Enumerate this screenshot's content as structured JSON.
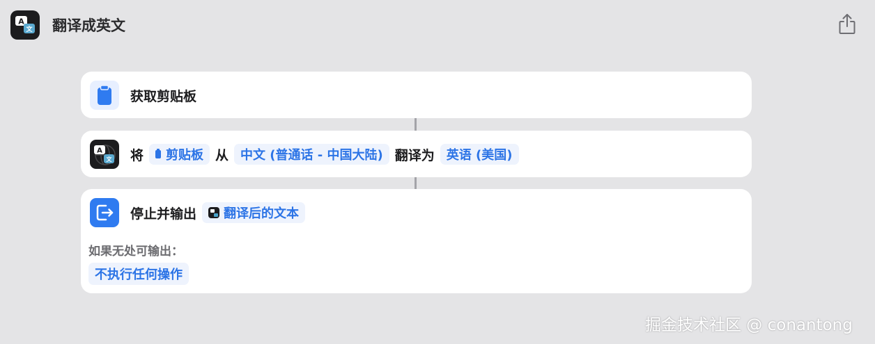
{
  "header": {
    "title": "翻译成英文",
    "app_icon": "translate-icon",
    "share_icon": "share-icon"
  },
  "actions": [
    {
      "icon": "clipboard-icon",
      "label": "获取剪贴板"
    },
    {
      "icon": "translate-icon",
      "prefix": "将",
      "input_token": "剪贴板",
      "from_word": "从",
      "source_language": "中文 (普通话 - 中国大陆)",
      "translate_to": "翻译为",
      "target_language": "英语 (美国)"
    },
    {
      "icon": "stop-output-icon",
      "label": "停止并输出",
      "output_token": "翻译后的文本",
      "fallback_label": "如果无处可输出：",
      "fallback_value": "不执行任何操作"
    }
  ],
  "watermark": "掘金技术社区 @ conantong",
  "colors": {
    "background": "#e4e4e6",
    "card": "#ffffff",
    "accent": "#2c74e6",
    "token_bg": "#eef3fd",
    "stop_icon": "#2f7bf0"
  }
}
